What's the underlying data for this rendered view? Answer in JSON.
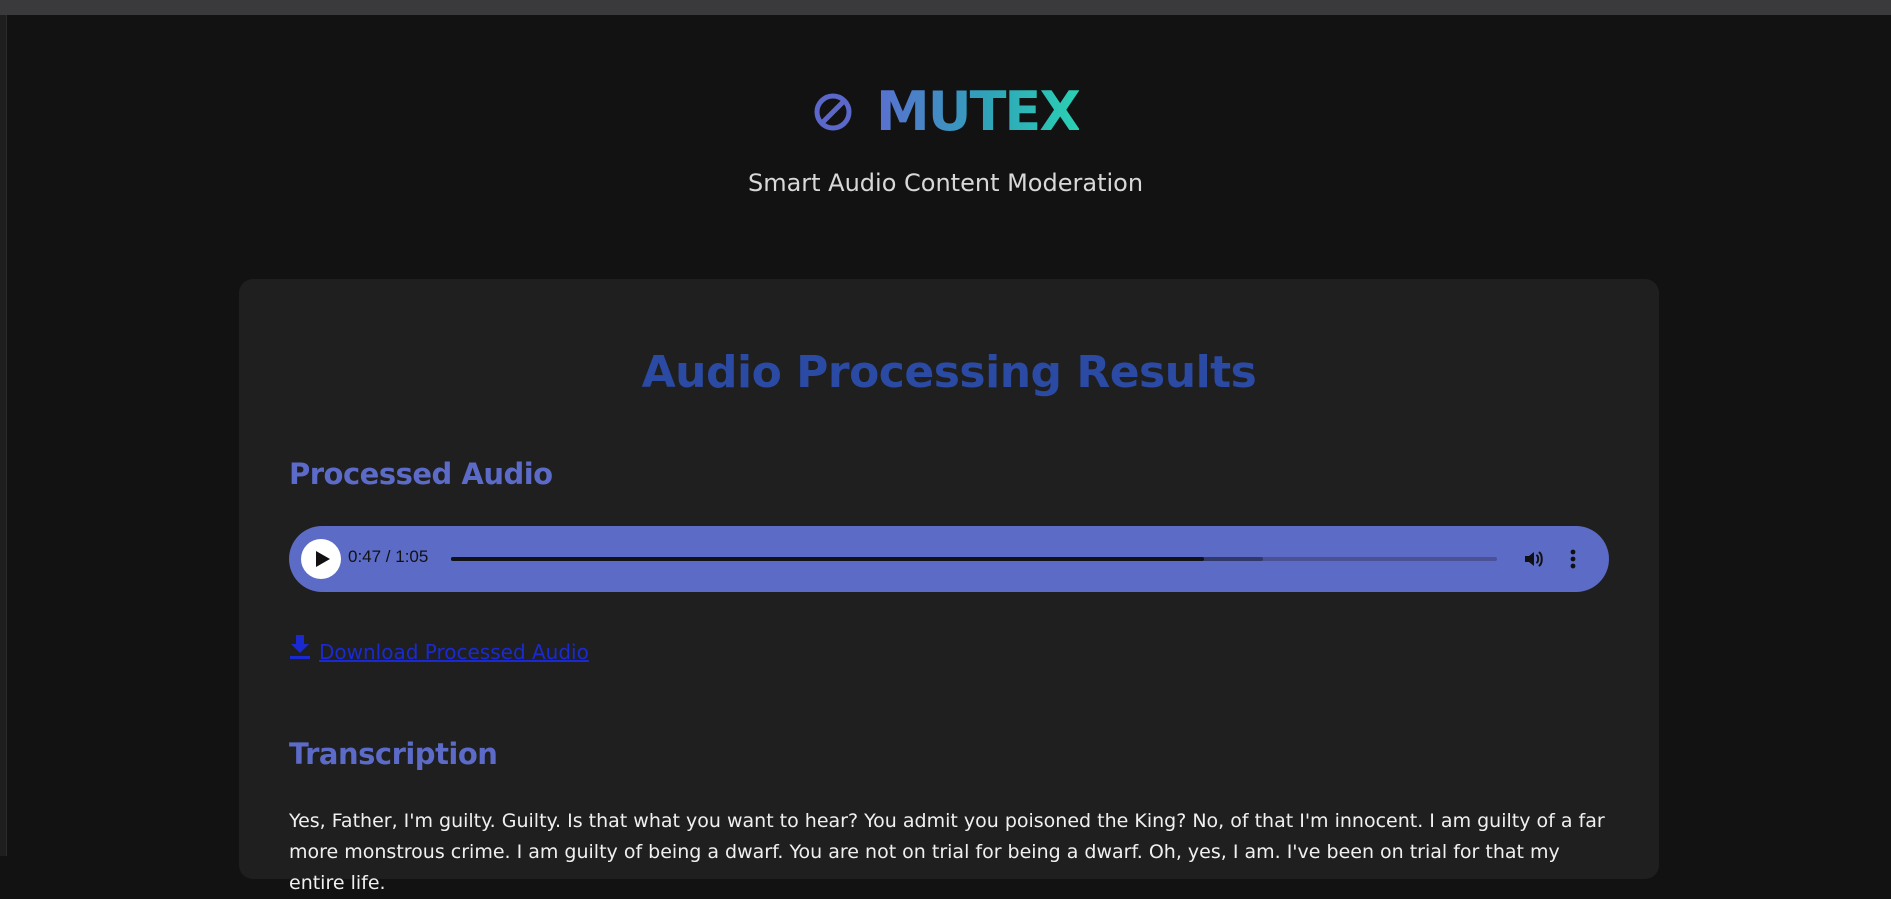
{
  "app": {
    "title": "MUTEX",
    "tagline": "Smart Audio Content Moderation",
    "icon": "prohibited-icon",
    "colors": {
      "background": "#121212",
      "card": "#1f1f1f",
      "accent": "#5c6bc5",
      "title_blue": "#2b4aa3",
      "link": "#1a2ad0"
    }
  },
  "results": {
    "title": "Audio Processing Results",
    "processed_audio": {
      "heading": "Processed Audio",
      "player": {
        "time_display": "0:47 / 1:05",
        "current_time": "0:47",
        "duration": "1:05",
        "progress_fraction": 0.72,
        "buffered_fraction": 0.776,
        "play_icon": "play-icon",
        "volume_icon": "volume-icon",
        "more_icon": "more-vert-icon"
      },
      "download": {
        "icon": "download-icon",
        "label": "Download Processed Audio"
      }
    },
    "transcription": {
      "heading": "Transcription",
      "text": "Yes, Father, I'm guilty. Guilty. Is that what you want to hear? You admit you poisoned the King? No, of that I'm innocent. I am guilty of a far more monstrous crime. I am guilty of being a dwarf. You are not on trial for being a dwarf. Oh, yes, I am. I've been on trial for that my entire life."
    }
  }
}
